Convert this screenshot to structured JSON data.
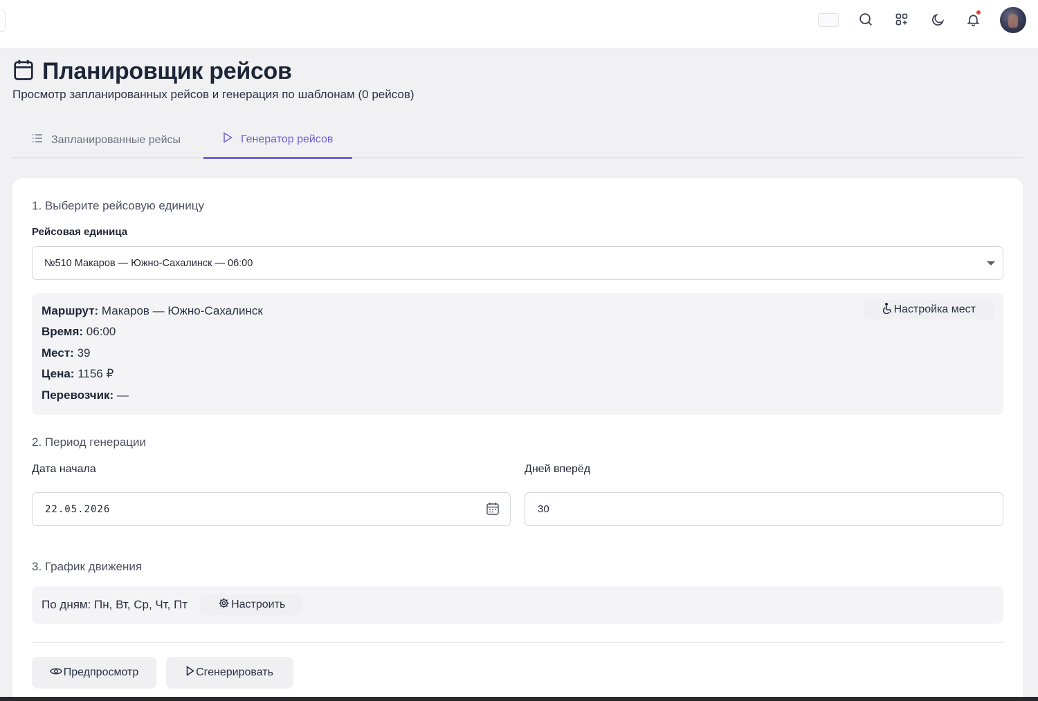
{
  "page": {
    "title": "Планировщик рейсов",
    "subtitle": "Просмотр запланированных рейсов и генерация по шаблонам (0 рейсов)"
  },
  "tabs": [
    {
      "label": "Запланированные рейсы",
      "icon": "list-icon",
      "active": false
    },
    {
      "label": "Генератор рейсов",
      "icon": "play-icon",
      "active": true
    }
  ],
  "section1": {
    "title": "1. Выберите рейсовую единицу",
    "field_label": "Рейсовая единица",
    "selected": "№510 Макаров — Южно-Сахалинск — 06:00"
  },
  "info": {
    "route_label": "Маршрут:",
    "route_value": " Макаров — Южно-Сахалинск",
    "time_label": "Время:",
    "time_value": " 06:00",
    "seats_label": "Мест:",
    "seats_value": " 39",
    "price_label": "Цена:",
    "price_value": " 1156 ₽",
    "carrier_label": "Перевозчик:",
    "carrier_value": " —",
    "seat_button": "Настройка мест"
  },
  "section2": {
    "title": "2. Период генерации",
    "start_label": "Дата начала",
    "start_value": "22.05.2026",
    "days_label": "Дней вперёд",
    "days_value": "30"
  },
  "section3": {
    "title": "3. График движения",
    "schedule_text": "По дням: Пн, Вт, Ср, Чт, Пт",
    "config_button": "Настроить"
  },
  "actions": {
    "preview": "Предпросмотр",
    "generate": "Сгенерировать"
  },
  "colors": {
    "accent": "#6c63d6",
    "notification": "#e0452d"
  }
}
